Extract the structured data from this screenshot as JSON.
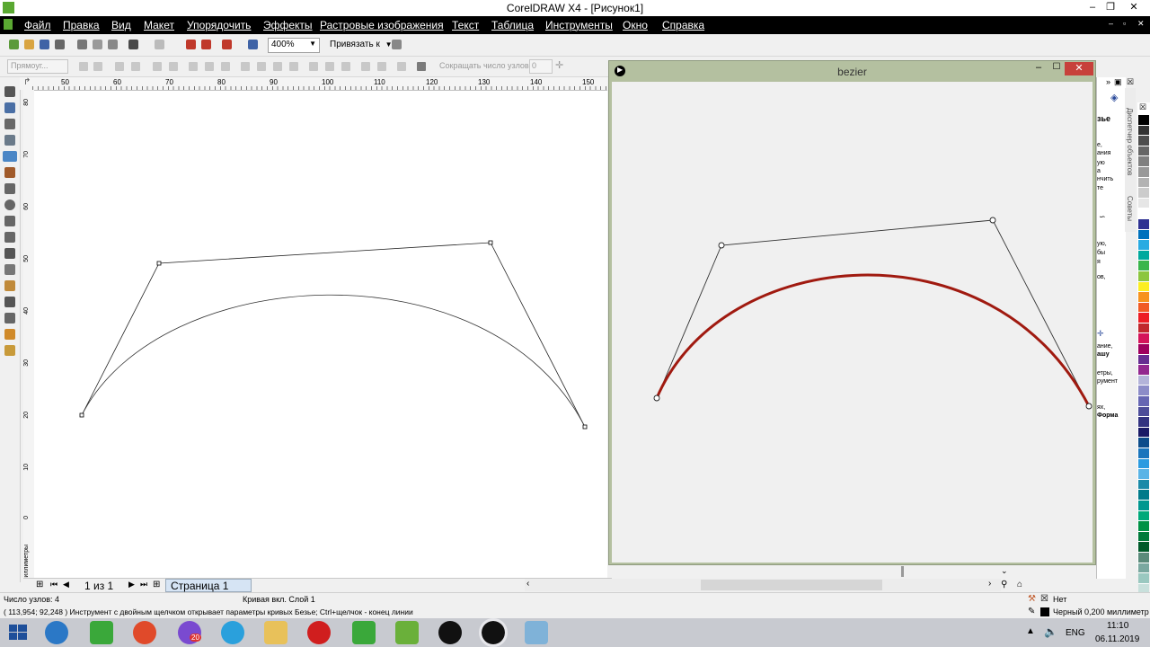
{
  "window": {
    "title": "CorelDRAW X4 - [Рисунок1]"
  },
  "menu": [
    "Файл",
    "Правка",
    "Вид",
    "Макет",
    "Упорядочить",
    "Эффекты",
    "Растровые изображения",
    "Текст",
    "Таблица",
    "Инструменты",
    "Окно",
    "Справка"
  ],
  "toolbar": {
    "zoom_value": "400%",
    "snap_label": "Привязать к"
  },
  "propbar": {
    "shape_select": "Прямоуг...",
    "reduce_nodes_label": "Сокращать число узлов",
    "reduce_nodes_value": "0"
  },
  "ruler": {
    "h_ticks": [
      "50",
      "60",
      "70",
      "80",
      "90",
      "100",
      "110",
      "120",
      "130",
      "140",
      "150"
    ],
    "v_ticks": [
      "80",
      "70",
      "60",
      "50",
      "40",
      "30",
      "20",
      "10",
      "0"
    ],
    "unit_label": "миллиметры"
  },
  "pagebar": {
    "page_count": "1 из 1",
    "page_tab": "Страница 1"
  },
  "bezier_window": {
    "title": "bezier"
  },
  "right_panel": {
    "docker_tabs": [
      "Диспетчер объектов",
      "Советы"
    ],
    "hint_texts": [
      "зье",
      "е,",
      "ания",
      "ую",
      "а",
      "нчить",
      "те",
      "ую,",
      "бы",
      "я",
      "ов,",
      "ание,",
      "ашу",
      "етры,",
      "румент",
      "ях,",
      "Форма"
    ]
  },
  "status": {
    "nodes": "Число узлов: 4",
    "curve_layer": "Кривая вкл. Слой 1",
    "coords_hint": "( 113,954; 92,248 ) Инструмент с двойным щелчком открывает параметры кривых Безье; Ctrl+щелчок - конец линии",
    "fill": "Нет",
    "outline": "Черный  0,200 миллиметр"
  },
  "taskbar": {
    "lang": "ENG",
    "time": "11:10",
    "date": "06.11.2019",
    "viber_badge": "20"
  },
  "colors": {
    "curve_red": "#a01a10",
    "menubar": "#000000",
    "bezier_frame": "#b4c0a0"
  }
}
